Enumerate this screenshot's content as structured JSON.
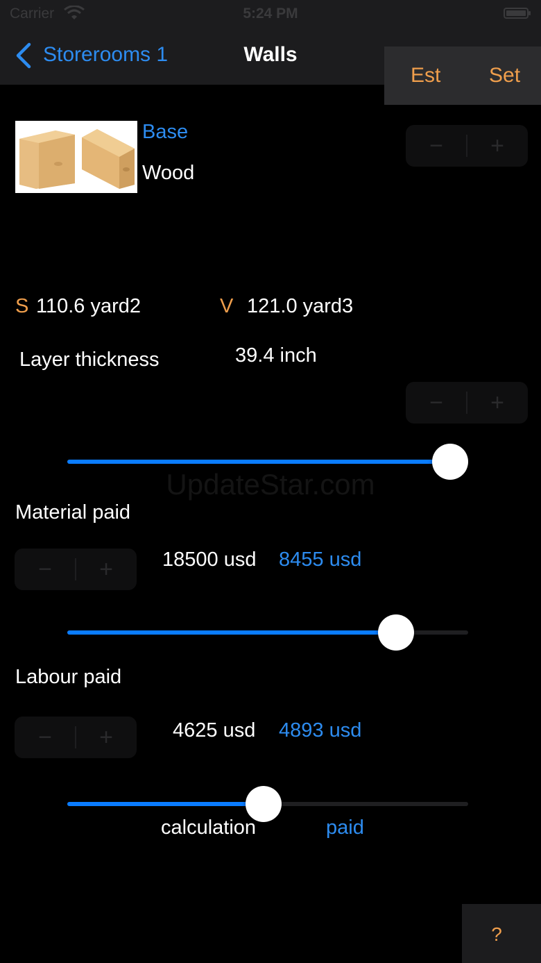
{
  "status_bar": {
    "carrier": "Carrier",
    "time": "5:24 PM"
  },
  "nav": {
    "back_label": "Storerooms 1",
    "title": "Walls",
    "est_label": "Est",
    "set_label": "Set"
  },
  "material": {
    "label": "Base",
    "name": "Wood"
  },
  "stats": {
    "s_letter": "S",
    "s_value": "110.6 yard2",
    "v_letter": "V",
    "v_value": "121.0 yard3"
  },
  "layer": {
    "label": "Layer thickness",
    "value": "39.4 inch",
    "slider_fraction": 0.96
  },
  "material_paid": {
    "label": "Material paid",
    "value": "18500 usd",
    "paid": "8455 usd",
    "slider_fraction": 0.82
  },
  "labour_paid": {
    "label": "Labour paid",
    "value": "4625 usd",
    "paid": "4893 usd",
    "slider_fraction": 0.49
  },
  "legend": {
    "calculation": "calculation",
    "paid": "paid"
  },
  "stepper": {
    "minus": "−",
    "plus": "+"
  },
  "watermark": "UpdateStar.com",
  "help": "?",
  "colors": {
    "accent_blue": "#2d8cf0",
    "accent_orange": "#ef9e4c",
    "slider_blue": "#0a7cff"
  },
  "icons": {
    "back": "chevron-left-icon",
    "wifi": "wifi-icon",
    "battery": "battery-icon"
  }
}
